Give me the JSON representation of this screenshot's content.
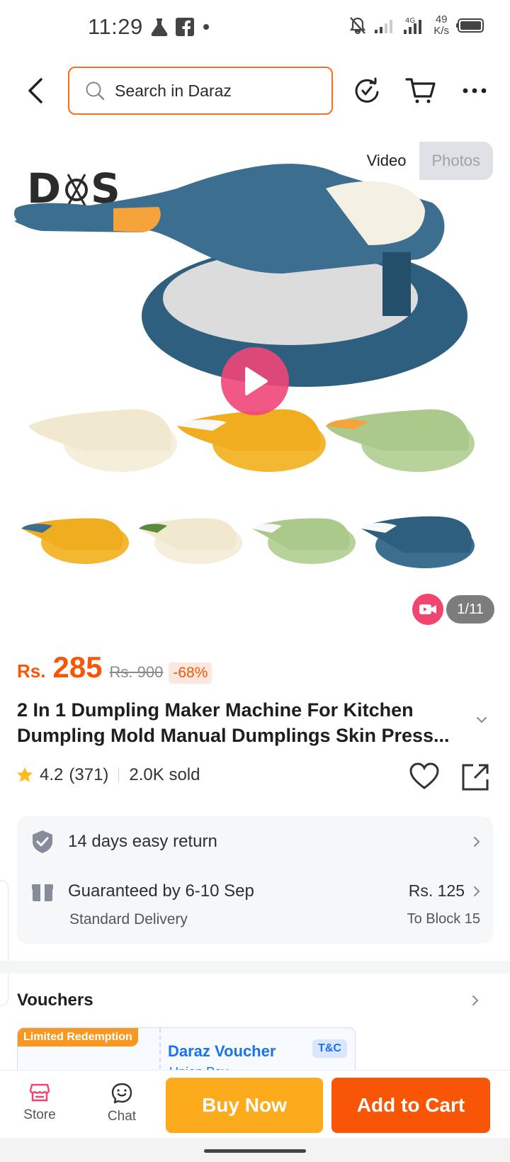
{
  "status_bar": {
    "time": "11:29",
    "network": "4G",
    "speed_value": "49",
    "speed_unit": "K/s"
  },
  "header": {
    "search_placeholder": "Search in Daraz"
  },
  "gallery": {
    "toggle_video": "Video",
    "toggle_photos": "Photos",
    "image_counter": "1/11",
    "product_colors": [
      "#3c6e8f",
      "#f5eeda",
      "#f4b731",
      "#b7d39b"
    ]
  },
  "product": {
    "currency": "Rs.",
    "price": "285",
    "original_price": "Rs. 900",
    "discount": "-68%",
    "title": "2 In 1 Dumpling Maker Machine For Kitchen Dumpling Mold Manual Dumplings Skin Press...",
    "rating": "4.2",
    "rating_count": "(371)",
    "sold": "2.0K sold"
  },
  "services": {
    "return_text": "14 days easy return",
    "delivery_text": "Guaranteed by 6-10 Sep",
    "delivery_sub": "Standard Delivery",
    "delivery_fee": "Rs. 125",
    "delivery_location": "To Block 15"
  },
  "vouchers": {
    "title": "Vouchers",
    "badge": "Limited Redemption",
    "card_title": "Daraz Voucher",
    "tc": "T&C",
    "card_sub": "Union Pay"
  },
  "bottom_bar": {
    "store": "Store",
    "chat": "Chat",
    "buy_now": "Buy Now",
    "add_to_cart": "Add to Cart"
  },
  "colors": {
    "brand_orange": "#f85606",
    "buy_now": "#fbab1c",
    "search_border": "#f36f21"
  }
}
